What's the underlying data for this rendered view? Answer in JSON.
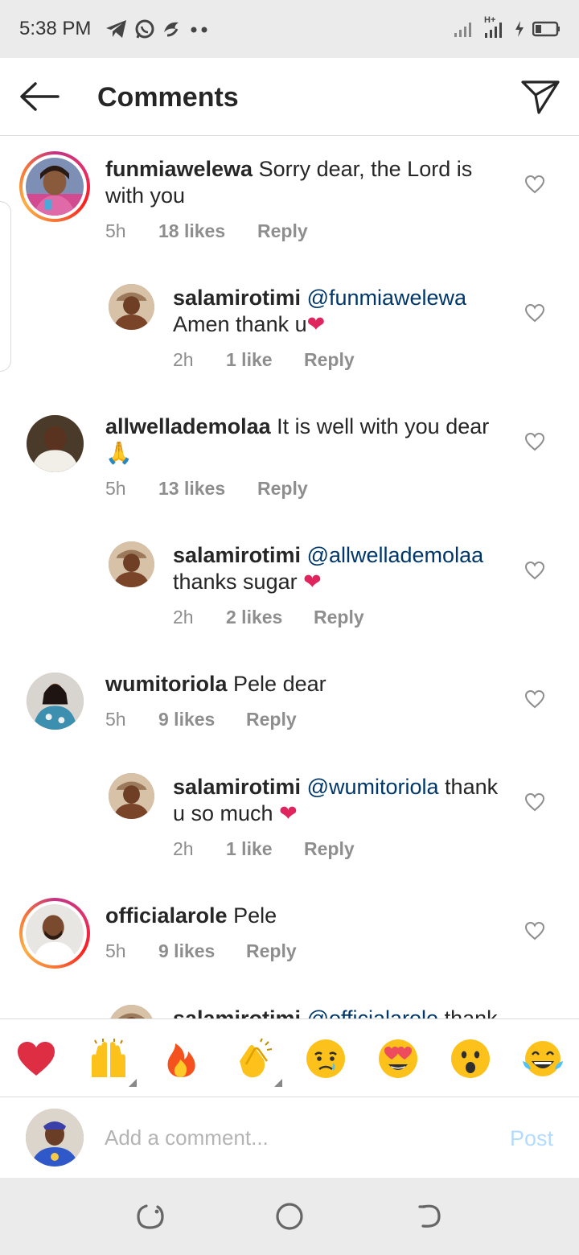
{
  "status_bar": {
    "time": "5:38 PM",
    "network": "H+"
  },
  "header": {
    "title": "Comments",
    "back_icon": "arrow-left-icon",
    "share_icon": "send-icon"
  },
  "comments": [
    {
      "username": "funmiawelewa",
      "mention": "",
      "line1": "Sorry dear, the Lord is",
      "line2": "with you",
      "time": "5h",
      "likes": "18 likes",
      "reply": "Reply"
    },
    {
      "username": "salamirotimi",
      "mention": "@funmiawelewa",
      "line1": "",
      "line2": "Amen thank u",
      "emoji": "❤",
      "time": "2h",
      "likes": "1 like",
      "reply": "Reply"
    },
    {
      "username": "allwellademolaa",
      "mention": "",
      "line1": "It is well with you dear",
      "line2": "🙏",
      "time": "5h",
      "likes": "13 likes",
      "reply": "Reply"
    },
    {
      "username": "salamirotimi",
      "mention": "@allwellademolaa",
      "line1": "",
      "line2": "thanks sugar",
      "emoji": "❤",
      "time": "2h",
      "likes": "2 likes",
      "reply": "Reply"
    },
    {
      "username": "wumitoriola",
      "mention": "",
      "line1": "Pele dear",
      "line2": "",
      "time": "5h",
      "likes": "9 likes",
      "reply": "Reply"
    },
    {
      "username": "salamirotimi",
      "mention": "@wumitoriola",
      "line1": "thank",
      "line2": "u so much",
      "emoji": "❤",
      "time": "2h",
      "likes": "1 like",
      "reply": "Reply"
    },
    {
      "username": "officialarole",
      "mention": "",
      "line1": "Pele",
      "line2": "",
      "time": "5h",
      "likes": "9 likes",
      "reply": "Reply"
    },
    {
      "username": "salamirotimi",
      "mention": "@officialarole",
      "line1": "thank",
      "line2": "",
      "time": "",
      "likes": "",
      "reply": ""
    }
  ],
  "emoji_bar": [
    "❤️",
    "🙌",
    "🔥",
    "👏",
    "😢",
    "😍",
    "😮",
    "😂"
  ],
  "composer": {
    "placeholder": "Add a comment...",
    "post_label": "Post"
  },
  "colors": {
    "link": "#00376b",
    "meta": "#8e8e8e",
    "post_disabled": "#b3dbff",
    "heart": "#e0245e"
  }
}
